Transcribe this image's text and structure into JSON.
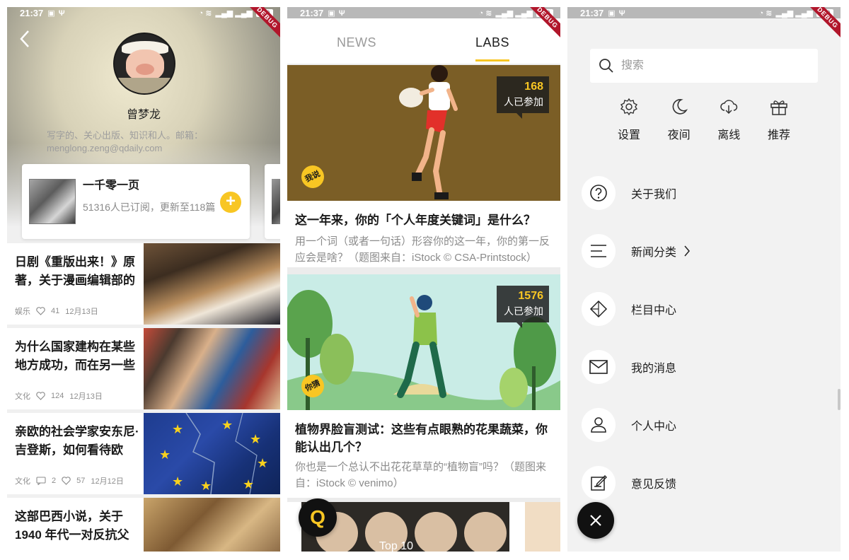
{
  "status_bar": {
    "time": "21:37",
    "battery": "100"
  },
  "debug_label": "DEBUG",
  "profile": {
    "name": "曾梦龙",
    "bio": "写字的、关心出版、知识和人。邮箱：",
    "email": "menglong.zeng@qdaily.com"
  },
  "column_card": {
    "title": "一千零一页",
    "subtitle": "51316人已订阅，更新至118篇",
    "add_label": "+"
  },
  "news_items": [
    {
      "title": "日剧《重版出来！》原著，关于漫画编辑部的",
      "category": "娱乐",
      "likes": "41",
      "comments": "",
      "date": "12月13日"
    },
    {
      "title": "为什么国家建构在某些地方成功，而在另一些",
      "category": "文化",
      "likes": "124",
      "comments": "",
      "date": "12月13日"
    },
    {
      "title": "亲欧的社会学家安东尼·吉登斯，如何看待欧",
      "category": "文化",
      "likes": "57",
      "comments": "2",
      "date": "12月12日"
    },
    {
      "title": "这部巴西小说，关于1940 年代一对反抗父",
      "category": "",
      "likes": "",
      "comments": "",
      "date": ""
    }
  ],
  "labs": {
    "tabs": [
      {
        "label": "NEWS",
        "active": false
      },
      {
        "label": "LABS",
        "active": true
      }
    ],
    "cards": [
      {
        "count": "168",
        "count_label": "人已参加",
        "badge": "我说",
        "title": "这一年来，你的「个人年度关键词」是什么？",
        "desc": "用一个词（或者一句话）形容你的这一年，你的第一反应会是啥？（题图来自：iStock © CSA-Printstock）"
      },
      {
        "count": "1576",
        "count_label": "人已参加",
        "badge": "你猜",
        "title": "植物界脸盲测试：这些有点眼熟的花果蔬菜，你能认出几个？",
        "desc": "你也是一个总认不出花花草草的“植物盲”吗？（题图来自：iStock © venimo）"
      }
    ],
    "third_card_label": "Top 10",
    "fab_label": "Q"
  },
  "menu": {
    "search_placeholder": "搜索",
    "quick_actions": [
      {
        "label": "设置",
        "icon": "gear-icon"
      },
      {
        "label": "夜间",
        "icon": "moon-icon"
      },
      {
        "label": "离线",
        "icon": "cloud-download-icon"
      },
      {
        "label": "推荐",
        "icon": "gift-icon"
      }
    ],
    "items": [
      {
        "label": "关于我们",
        "icon": "question-icon"
      },
      {
        "label": "新闻分类",
        "icon": "list-icon"
      },
      {
        "label": "栏目中心",
        "icon": "diamond-icon"
      },
      {
        "label": "我的消息",
        "icon": "mail-icon"
      },
      {
        "label": "个人中心",
        "icon": "user-icon"
      },
      {
        "label": "意见反馈",
        "icon": "edit-icon"
      }
    ]
  },
  "colors": {
    "accent": "#f8c623",
    "dark": "#111111",
    "debug": "#b1162b"
  }
}
